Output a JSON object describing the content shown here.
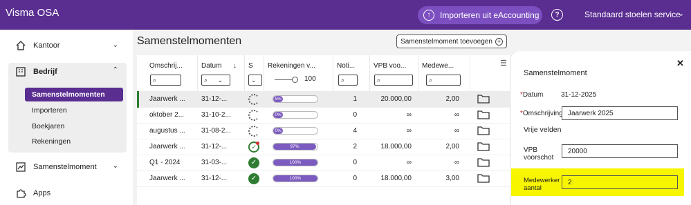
{
  "app": {
    "title": "Visma OSA",
    "import_button": "Importeren uit eAccounting",
    "company": "Standaard stoelen service"
  },
  "sidebar": {
    "items": [
      {
        "label": "Kantoor"
      },
      {
        "label": "Bedrijf"
      },
      {
        "label": "Samenstelmoment"
      },
      {
        "label": "Apps"
      }
    ],
    "bedrijf_sub": [
      {
        "label": "Samenstelmomenten"
      },
      {
        "label": "Importeren"
      },
      {
        "label": "Boekjaren"
      },
      {
        "label": "Rekeningen"
      }
    ]
  },
  "main": {
    "title": "Samenstelmomenten",
    "add_button": "Samenstelmoment toevoegen",
    "columns": [
      {
        "label": "Omschrij..."
      },
      {
        "label": "Datum"
      },
      {
        "label": "S"
      },
      {
        "label": "Rekeningen v..."
      },
      {
        "label": "Noti..."
      },
      {
        "label": "VPB voo..."
      },
      {
        "label": "Medewe..."
      }
    ],
    "slider_value": "100",
    "rows": [
      {
        "omschrijving": "Jaarwerk ...",
        "datum": "31-12-...",
        "status": "progress",
        "pct_label": "5%",
        "pct": 5,
        "notities": "1",
        "vpb": "20.000,00",
        "medewerker": "2,00"
      },
      {
        "omschrijving": "oktober 2...",
        "datum": "31-10-2...",
        "status": "progress",
        "pct_label": "0%",
        "pct": 0,
        "notities": "0",
        "vpb": "∞",
        "medewerker": "∞"
      },
      {
        "omschrijving": "augustus ...",
        "datum": "31-08-2...",
        "status": "progress",
        "pct_label": "0%",
        "pct": 0,
        "notities": "4",
        "vpb": "∞",
        "medewerker": "∞"
      },
      {
        "omschrijving": "Jaarwerk ...",
        "datum": "31-12-...",
        "status": "partial",
        "pct_label": "97%",
        "pct": 97,
        "notities": "2",
        "vpb": "18.000,00",
        "medewerker": "2,00"
      },
      {
        "omschrijving": "Q1 - 2024",
        "datum": "31-03-...",
        "status": "done",
        "pct_label": "100%",
        "pct": 100,
        "notities": "0",
        "vpb": "∞",
        "medewerker": "∞"
      },
      {
        "omschrijving": "Jaarwerk ...",
        "datum": "31-12-...",
        "status": "done",
        "pct_label": "100%",
        "pct": 100,
        "notities": "0",
        "vpb": "18.000,00",
        "medewerker": "3,00"
      }
    ]
  },
  "panel": {
    "title": "Samenstelmoment",
    "datum_label": "Datum",
    "datum_value": "31-12-2025",
    "omschrijving_label": "Omschrijving",
    "omschrijving_value": "Jaarwerk 2025",
    "vrije_velden": "Vrije velden",
    "vpb_label_1": "VPB",
    "vpb_label_2": "voorschot",
    "vpb_value": "20000",
    "medewerker_label_1": "Medewerker",
    "medewerker_label_2": "aantal",
    "medewerker_value": "2"
  },
  "colors": {
    "brand": "#5a2d91",
    "progress": "#7b5bbf",
    "success": "#2e7d32",
    "highlight": "#f7f500"
  }
}
